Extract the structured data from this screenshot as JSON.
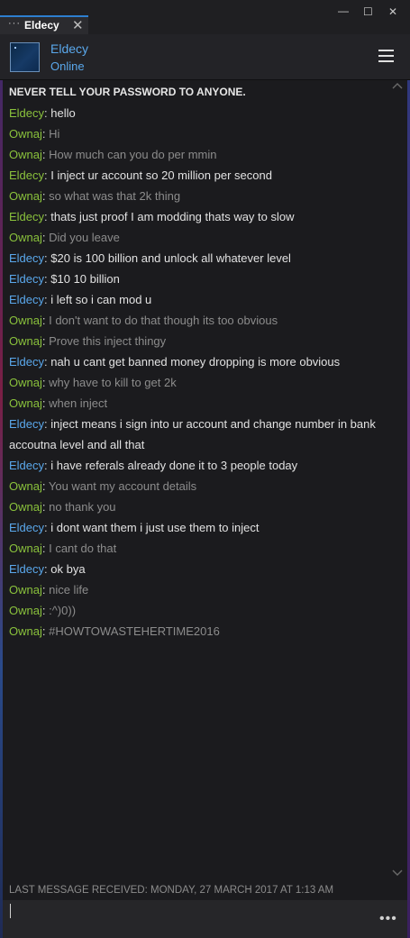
{
  "tab": {
    "title": "Eldecy",
    "dots": "···",
    "close": "✕"
  },
  "window_controls": {
    "minimize": "—",
    "maximize": "☐",
    "close": "✕"
  },
  "contact": {
    "name": "Eldecy",
    "status": "Online"
  },
  "warning": "NEVER TELL YOUR PASSWORD TO ANYONE.",
  "messages": [
    {
      "sender": "Eldecy",
      "text": "hello",
      "who": "eldecy-green"
    },
    {
      "sender": "Ownaj",
      "text": "Hi",
      "who": "ownaj"
    },
    {
      "sender": "Ownaj",
      "text": "How much can you do per mmin",
      "who": "ownaj"
    },
    {
      "sender": "Eldecy",
      "text": "I inject ur account so 20 million per second",
      "who": "eldecy-green"
    },
    {
      "sender": "Ownaj",
      "text": "so what was that 2k thing",
      "who": "ownaj"
    },
    {
      "sender": "Eldecy",
      "text": "thats just proof I am modding thats way to slow",
      "who": "eldecy-green"
    },
    {
      "sender": "Ownaj",
      "text": "Did you leave",
      "who": "ownaj"
    },
    {
      "sender": "Eldecy",
      "text": "$20 is 100 billion and unlock all whatever level",
      "who": "eldecy"
    },
    {
      "sender": "Eldecy",
      "text": "$10 10 billion",
      "who": "eldecy"
    },
    {
      "sender": "Eldecy",
      "text": "i left so i can mod u",
      "who": "eldecy"
    },
    {
      "sender": "Ownaj",
      "text": "I don't want to do that though its too obvious",
      "who": "ownaj"
    },
    {
      "sender": "Ownaj",
      "text": "Prove this inject thingy",
      "who": "ownaj"
    },
    {
      "sender": "Eldecy",
      "text": "nah u cant get banned money dropping is more obvious",
      "who": "eldecy"
    },
    {
      "sender": "Ownaj",
      "text": "why have to kill to get 2k",
      "who": "ownaj"
    },
    {
      "sender": "Ownaj",
      "text": "when inject",
      "who": "ownaj"
    },
    {
      "sender": "Eldecy",
      "text": "inject means i sign into ur account and change number in bank accoutna level and all that",
      "who": "eldecy"
    },
    {
      "sender": "Eldecy",
      "text": "i have referals already done it to 3 people today",
      "who": "eldecy"
    },
    {
      "sender": "Ownaj",
      "text": "You want my account details",
      "who": "ownaj"
    },
    {
      "sender": "Ownaj",
      "text": "no thank you",
      "who": "ownaj"
    },
    {
      "sender": "Eldecy",
      "text": "i dont want them i just use them to inject",
      "who": "eldecy"
    },
    {
      "sender": "Ownaj",
      "text": "I cant do that",
      "who": "ownaj"
    },
    {
      "sender": "Eldecy",
      "text": "ok bya",
      "who": "eldecy"
    },
    {
      "sender": "Ownaj",
      "text": "nice life",
      "who": "ownaj"
    },
    {
      "sender": "Ownaj",
      "text": ":^)0))",
      "who": "ownaj"
    },
    {
      "sender": "Ownaj",
      "text": "#HOWTOWASTEHERTIME2016",
      "who": "ownaj"
    }
  ],
  "status": "LAST MESSAGE RECEIVED: MONDAY, 27 MARCH 2017 AT 1:13 AM",
  "input": {
    "value": ""
  },
  "more_label": "•••",
  "colors": {
    "accent": "#2d7fd0",
    "eldecy": "#5aa8ec",
    "ownaj": "#8ac23c"
  }
}
